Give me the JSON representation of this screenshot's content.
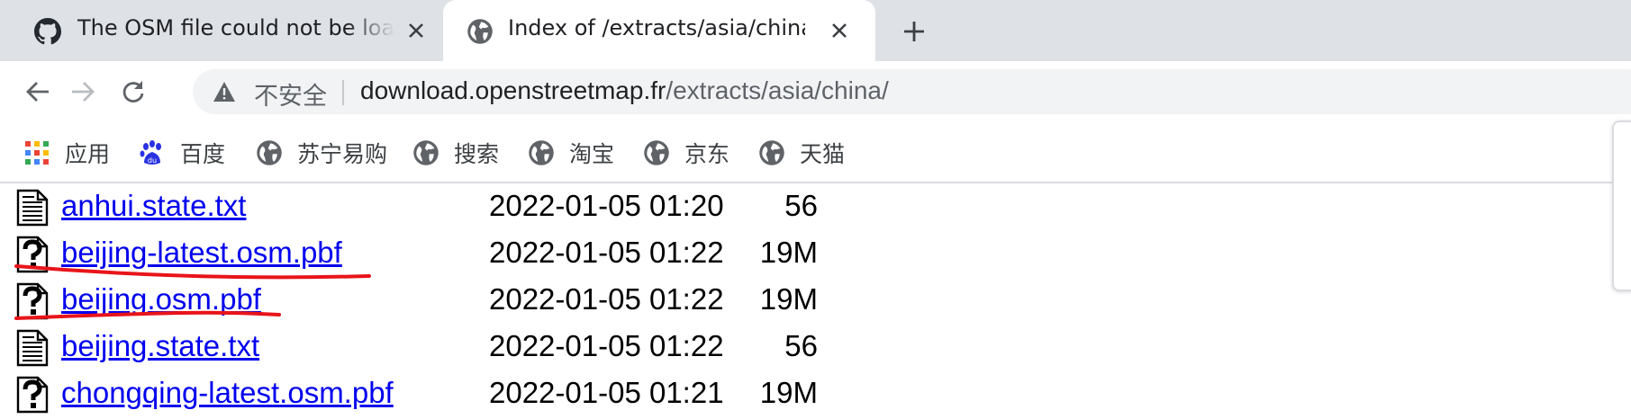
{
  "tabs": [
    {
      "title": "The OSM file could not be loaded",
      "favicon": "github-icon",
      "active": false
    },
    {
      "title": "Index of /extracts/asia/china",
      "favicon": "globe-icon",
      "active": true
    }
  ],
  "toolbar": {
    "security_label": "不安全",
    "url_host": "download.openstreetmap.fr",
    "url_path": "/extracts/asia/china/"
  },
  "bookmarks": [
    {
      "label": "应用",
      "icon": "apps-grid-icon"
    },
    {
      "label": "百度",
      "icon": "baidu-paw-icon"
    },
    {
      "label": "苏宁易购",
      "icon": "globe-icon"
    },
    {
      "label": "搜索",
      "icon": "globe-icon"
    },
    {
      "label": "淘宝",
      "icon": "globe-icon"
    },
    {
      "label": "京东",
      "icon": "globe-icon"
    },
    {
      "label": "天猫",
      "icon": "globe-icon"
    }
  ],
  "listing": [
    {
      "name": "anhui.state.txt",
      "date": "2022-01-05 01:20",
      "size": "56",
      "icon": "text-file-icon",
      "highlighted": false
    },
    {
      "name": "beijing-latest.osm.pbf",
      "date": "2022-01-05 01:22",
      "size": "19M",
      "icon": "unknown-file-icon",
      "highlighted": true
    },
    {
      "name": "beijing.osm.pbf",
      "date": "2022-01-05 01:22",
      "size": "19M",
      "icon": "unknown-file-icon",
      "highlighted": true
    },
    {
      "name": "beijing.state.txt",
      "date": "2022-01-05 01:22",
      "size": "56",
      "icon": "text-file-icon",
      "highlighted": false
    },
    {
      "name": "chongqing-latest.osm.pbf",
      "date": "2022-01-05 01:21",
      "size": "19M",
      "icon": "unknown-file-icon",
      "highlighted": false
    }
  ],
  "colors": {
    "link": "#0000ee",
    "annotation": "#e8141a",
    "tabstrip": "#dee1e6"
  }
}
